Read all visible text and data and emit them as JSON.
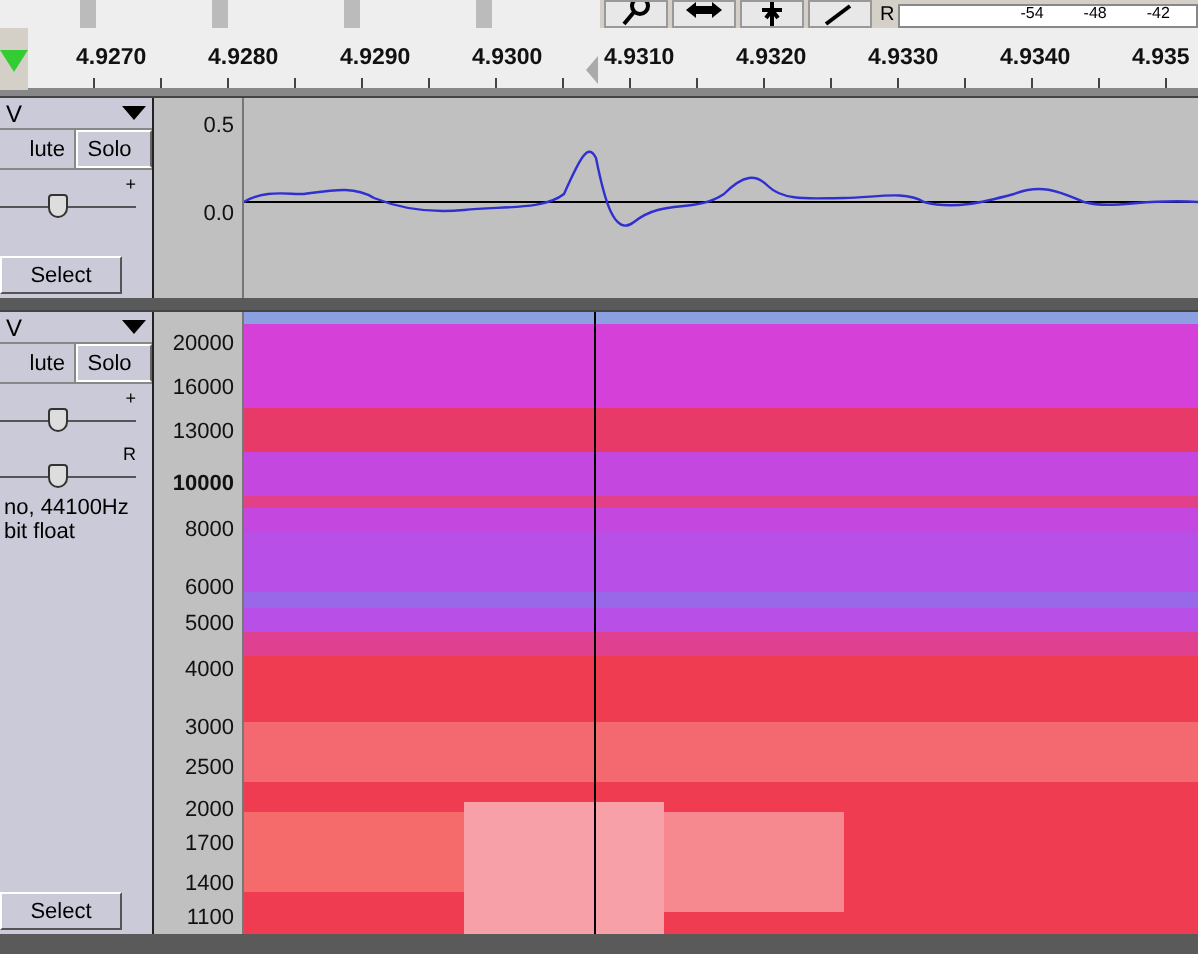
{
  "toolbar": {
    "meter_channel": "R",
    "meter_ticks": [
      "-54",
      "-48",
      "-42"
    ]
  },
  "ruler": {
    "ticks": [
      "4.9270",
      "4.9280",
      "4.9290",
      "4.9300",
      "4.9310",
      "4.9320",
      "4.9330",
      "4.9340",
      "4.935"
    ]
  },
  "tracks": [
    {
      "kind": "waveform",
      "name": "V",
      "mute": "lute",
      "solo": "Solo",
      "gain": {
        "label": "+",
        "level": 0.43
      },
      "select": "Select",
      "scale": [
        "0.5",
        "0.0"
      ]
    },
    {
      "kind": "spectrogram",
      "name": "V",
      "mute": "lute",
      "solo": "Solo",
      "gain": {
        "label": "+",
        "level": 0.43
      },
      "pan": {
        "label": "R",
        "level": 0.43
      },
      "info": [
        "no, 44100Hz",
        "bit float"
      ],
      "select": "Select",
      "scale": [
        "20000",
        "16000",
        "13000",
        "10000",
        "8000",
        "6000",
        "5000",
        "4000",
        "3000",
        "2500",
        "2000",
        "1700",
        "1400",
        "1100"
      ]
    }
  ]
}
